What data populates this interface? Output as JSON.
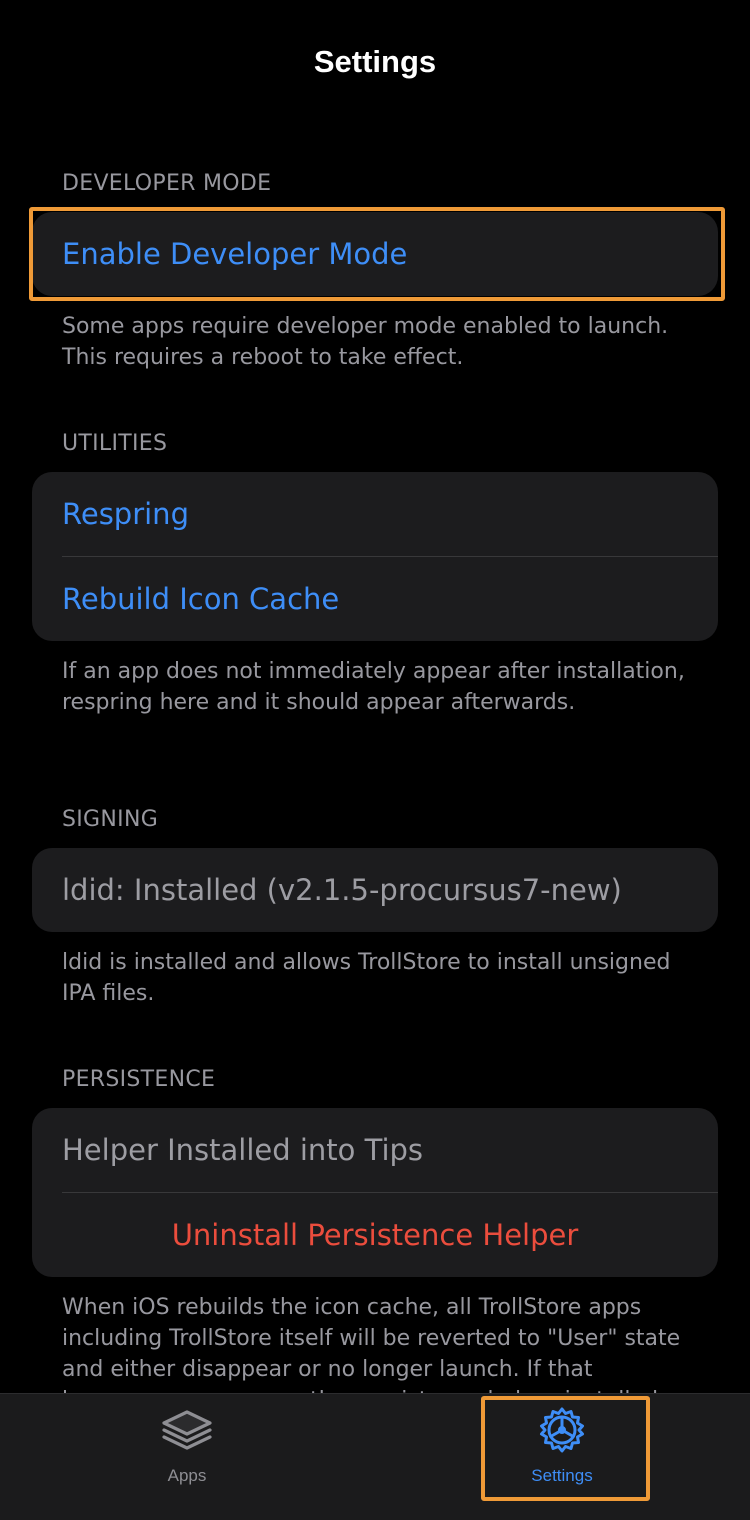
{
  "nav": {
    "title": "Settings"
  },
  "sections": {
    "developer": {
      "header": "DEVELOPER MODE",
      "enable_label": "Enable Developer Mode",
      "footer": "Some apps require developer mode enabled to launch. This requires a reboot to take effect."
    },
    "utilities": {
      "header": "UTILITIES",
      "respring_label": "Respring",
      "rebuild_label": "Rebuild Icon Cache",
      "footer": "If an app does not immediately appear after installation, respring here and it should appear afterwards."
    },
    "signing": {
      "header": "SIGNING",
      "ldid_status": "ldid: Installed (v2.1.5-procursus7-new)",
      "footer": "ldid is installed and allows TrollStore to install unsigned IPA files."
    },
    "persistence": {
      "header": "PERSISTENCE",
      "helper_status": "Helper Installed into Tips",
      "uninstall_label": "Uninstall Persistence Helper",
      "footer": "When iOS rebuilds the icon cache, all TrollStore apps including TrollStore itself will be reverted to \"User\" state and either disappear or no longer launch. If that happens, you can use the persistence helper installed"
    }
  },
  "tabbar": {
    "apps": {
      "label": "Apps",
      "icon": "stack-icon",
      "selected": false
    },
    "settings": {
      "label": "Settings",
      "icon": "gear-icon",
      "selected": true
    }
  },
  "colors": {
    "accent": "#3e8ef7",
    "destructive": "#eb4d3d",
    "highlight_box": "#ef9a37",
    "cell_background": "#1c1c1e",
    "tab_inactive": "#8e8e93"
  }
}
